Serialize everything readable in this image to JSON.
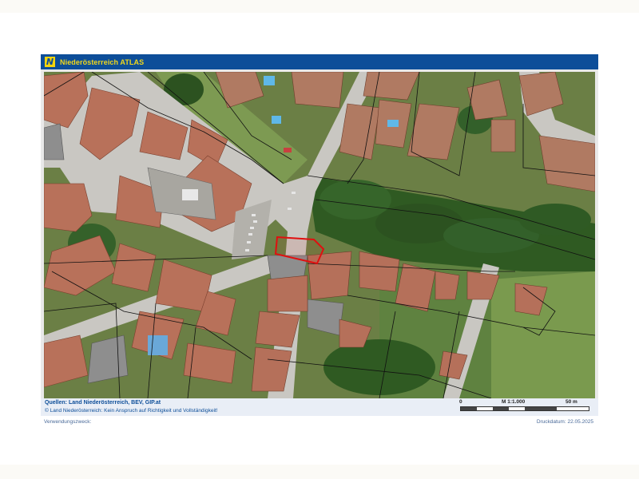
{
  "header": {
    "logo_text": "N",
    "title": "Niederösterreich ATLAS"
  },
  "map": {
    "description_colors": {
      "vegetation": "#3f6b2a",
      "roof_terracotta": "#b8715a",
      "road": "#c8c6c2",
      "parcel_line": "#111111",
      "highlight_parcel": "#e01010"
    }
  },
  "footer": {
    "sources": "Quellen: Land Niederösterreich, BEV, GIP.at",
    "copyright": "© Land Niederösterreich: Kein Anspruch auf Richtigkeit und Vollständigkeit!",
    "scale": {
      "start": "0",
      "ratio": "M 1:1.000",
      "end": "50 m"
    },
    "purpose_label": "Verwendungszweck:",
    "print_date": "Druckdatum: 22.05.2025"
  },
  "colors": {
    "brand_blue": "#0d4e99",
    "brand_yellow": "#f2d81a"
  }
}
